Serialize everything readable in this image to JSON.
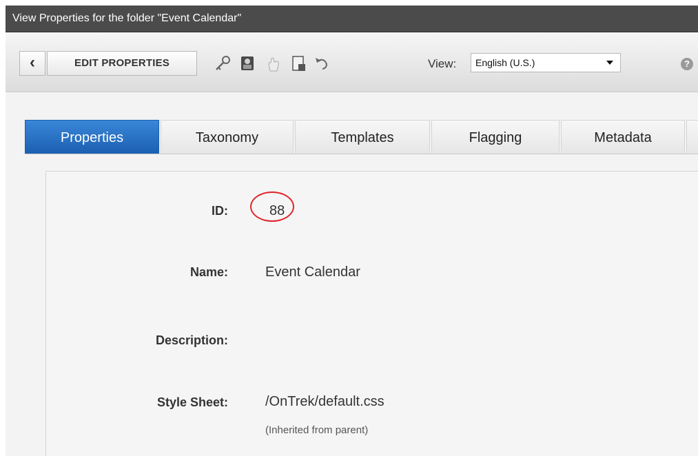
{
  "window": {
    "title": "View Properties for the folder \"Event Calendar\""
  },
  "toolbar": {
    "back_icon": "chevron-left-icon",
    "edit_label": "EDIT PROPERTIES",
    "icons": [
      "key-icon",
      "user-permissions-icon",
      "hand-icon",
      "document-icon",
      "undo-icon"
    ],
    "view_label": "View:",
    "view_selected": "English (U.S.)",
    "help_icon": "help-icon"
  },
  "tabs": [
    {
      "label": "Properties",
      "active": true
    },
    {
      "label": "Taxonomy",
      "active": false
    },
    {
      "label": "Templates",
      "active": false
    },
    {
      "label": "Flagging",
      "active": false
    },
    {
      "label": "Metadata",
      "active": false
    }
  ],
  "properties": {
    "id_label": "ID:",
    "id_value": "88",
    "name_label": "Name:",
    "name_value": "Event Calendar",
    "description_label": "Description:",
    "description_value": "",
    "stylesheet_label": "Style Sheet:",
    "stylesheet_value": "/OnTrek/default.css",
    "stylesheet_note": "(Inherited from parent)"
  },
  "colors": {
    "titlebar": "#4b4b4b",
    "active_tab": "#1b5fb0",
    "highlight_circle": "#e0232a"
  }
}
